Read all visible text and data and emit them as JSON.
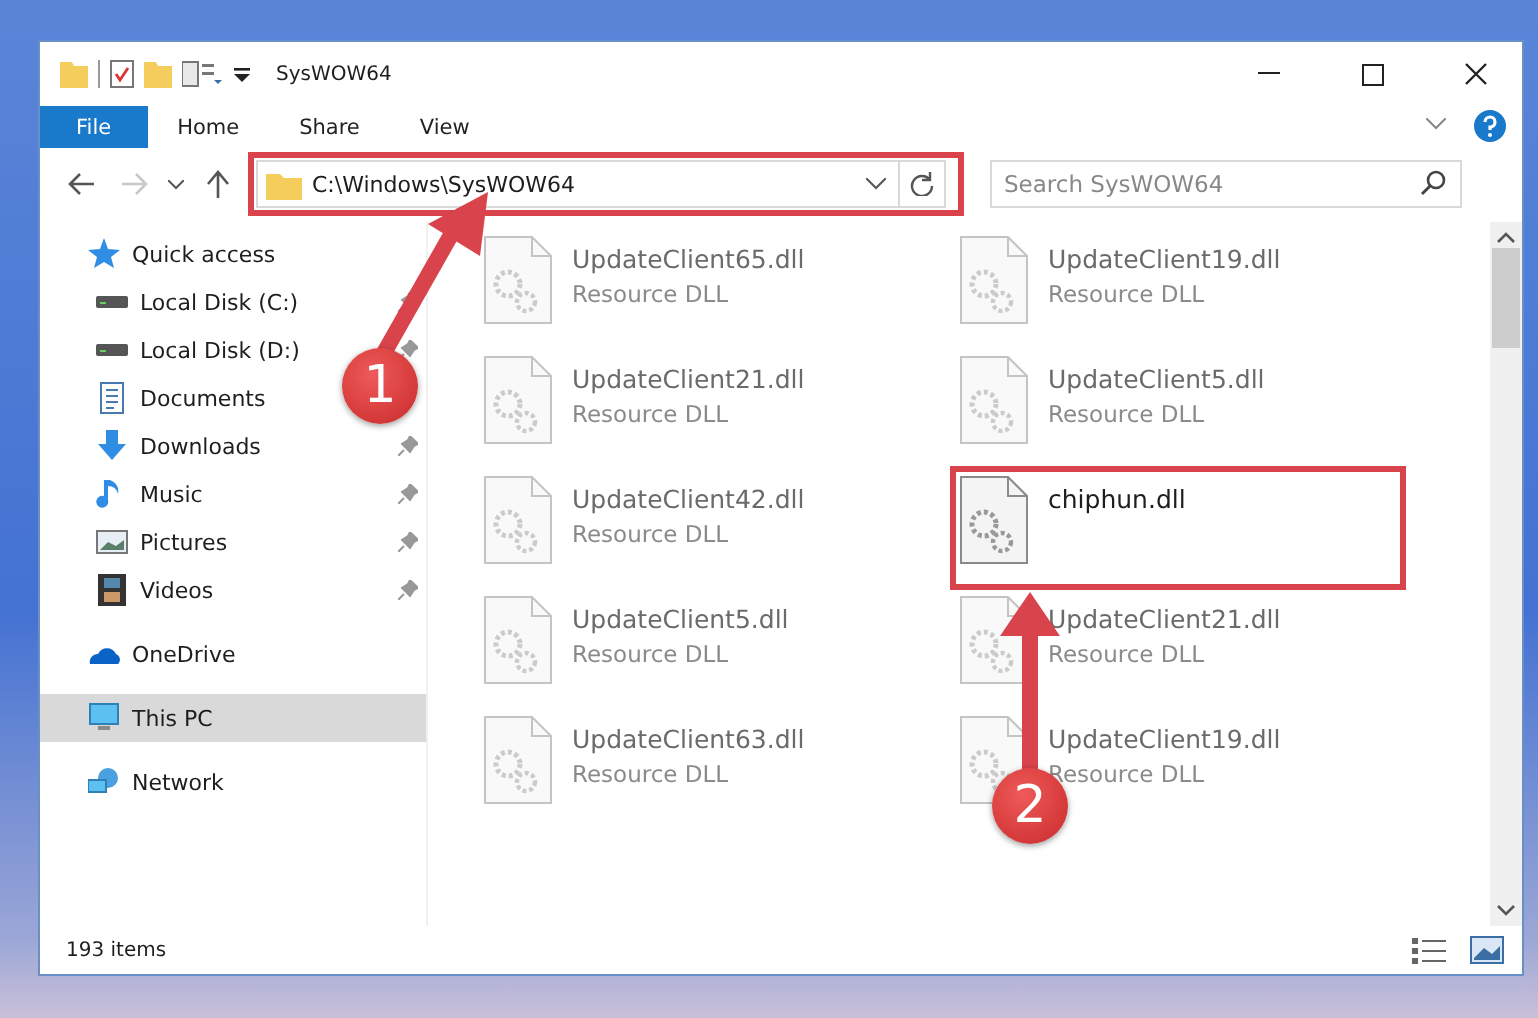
{
  "window": {
    "title": "SysWOW64"
  },
  "ribbon_tabs": [
    {
      "label": "File",
      "selected": true
    },
    {
      "label": "Home",
      "selected": false
    },
    {
      "label": "Share",
      "selected": false
    },
    {
      "label": "View",
      "selected": false
    }
  ],
  "address_bar": {
    "path": "C:\\Windows\\SysWOW64"
  },
  "search": {
    "placeholder": "Search SysWOW64"
  },
  "sidebar": {
    "items": [
      {
        "label": "Quick access",
        "kind": "star",
        "selected": false,
        "children": [
          {
            "label": "Local Disk (C:)",
            "kind": "drive",
            "pinned": true,
            "selected": false
          },
          {
            "label": "Local Disk (D:)",
            "kind": "drive",
            "pinned": true,
            "selected": false
          },
          {
            "label": "Documents",
            "kind": "documents",
            "pinned": false,
            "selected": false
          },
          {
            "label": "Downloads",
            "kind": "downloads",
            "pinned": true,
            "selected": false
          },
          {
            "label": "Music",
            "kind": "music",
            "pinned": true,
            "selected": false
          },
          {
            "label": "Pictures",
            "kind": "pictures",
            "pinned": true,
            "selected": false
          },
          {
            "label": "Videos",
            "kind": "videos",
            "pinned": true,
            "selected": false
          }
        ]
      },
      {
        "label": "OneDrive",
        "kind": "cloud",
        "selected": false
      },
      {
        "label": "This PC",
        "kind": "pc",
        "selected": true
      },
      {
        "label": "Network",
        "kind": "network",
        "selected": false
      }
    ]
  },
  "files": [
    {
      "name": "UpdateClient65.dll",
      "type": "Resource DLL",
      "dimmed": true
    },
    {
      "name": "UpdateClient19.dll",
      "type": "Resource DLL",
      "dimmed": true
    },
    {
      "name": "UpdateClient21.dll",
      "type": "Resource DLL",
      "dimmed": true
    },
    {
      "name": "UpdateClient5.dll",
      "type": "Resource DLL",
      "dimmed": true
    },
    {
      "name": "UpdateClient42.dll",
      "type": "Resource DLL",
      "dimmed": true
    },
    {
      "name": "chiphun.dll",
      "dimmed": false
    },
    {
      "name": "UpdateClient5.dll",
      "type": "Resource DLL",
      "dimmed": true
    },
    {
      "name": "UpdateClient21.dll",
      "type": "Resource DLL",
      "dimmed": true
    },
    {
      "name": "UpdateClient63.dll",
      "type": "Resource DLL",
      "dimmed": true
    },
    {
      "name": "UpdateClient19.dll",
      "type": "Resource DLL",
      "dimmed": true
    }
  ],
  "status_bar": {
    "item_count": "193 items"
  },
  "annotations": [
    {
      "label": "1"
    },
    {
      "label": "2"
    }
  ]
}
